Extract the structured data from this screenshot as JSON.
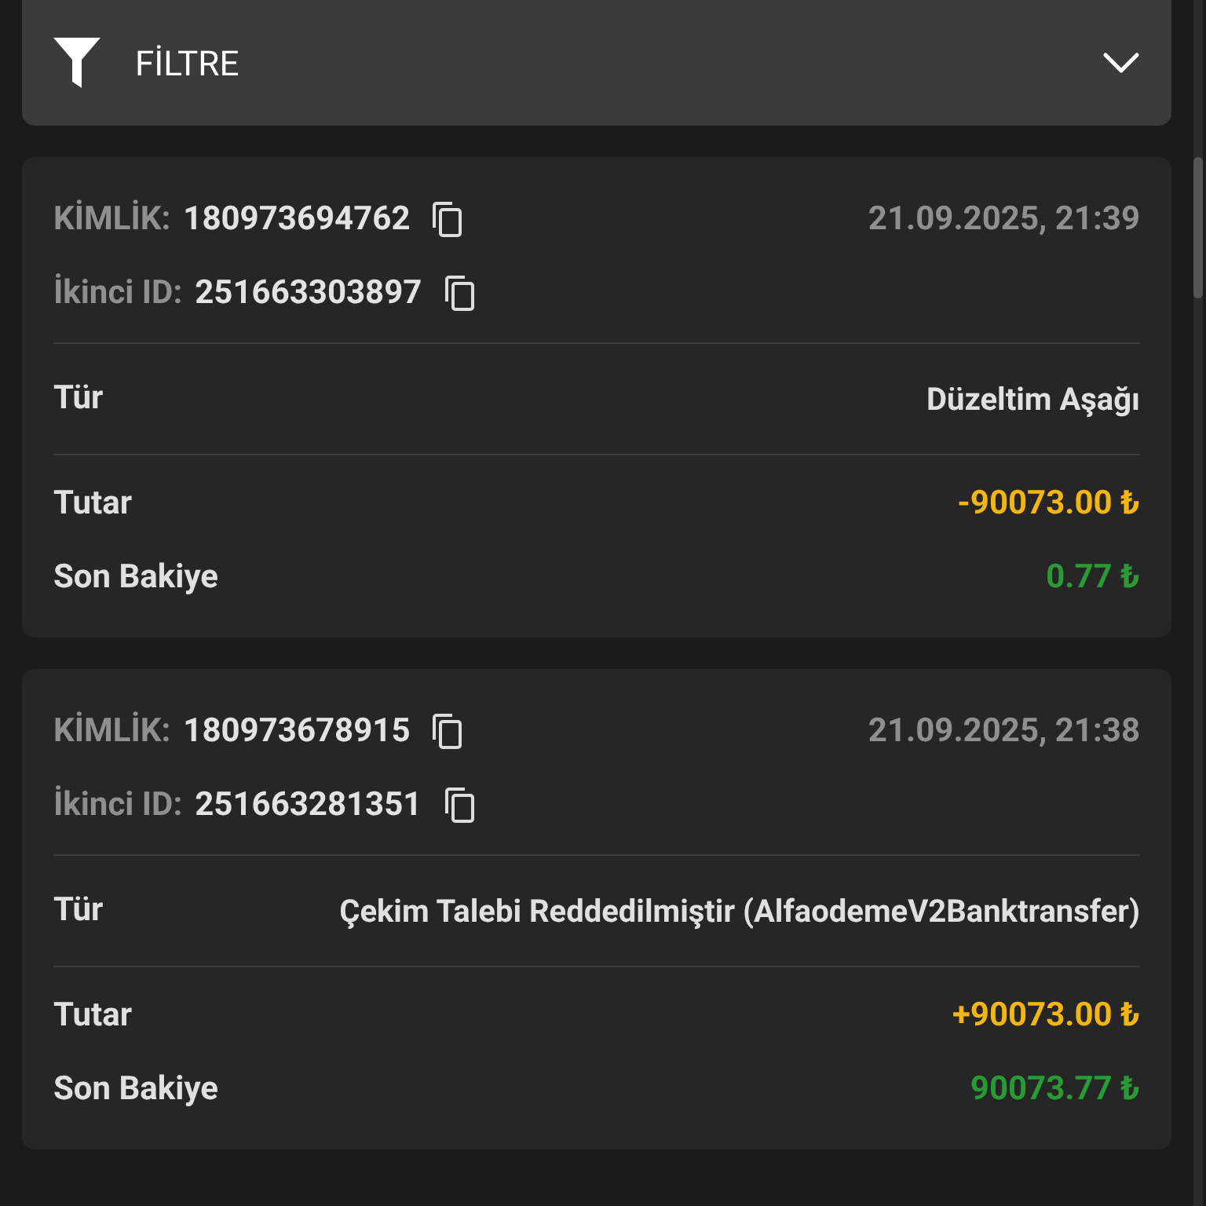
{
  "filter": {
    "label": "FİLTRE",
    "expanded": false
  },
  "transactions": [
    {
      "id_label": "KİMLİK:",
      "id": "180973694762",
      "secondary_label": "İkinci ID:",
      "secondary_id": "251663303897",
      "date": "21.09.2025, 21:39",
      "type_label": "Tür",
      "type": "Düzeltim Aşağı",
      "amount_label": "Tutar",
      "amount": "-90073.00 ₺",
      "balance_label": "Son Bakiye",
      "balance": "0.77 ₺"
    },
    {
      "id_label": "KİMLİK:",
      "id": "180973678915",
      "secondary_label": "İkinci ID:",
      "secondary_id": "251663281351",
      "date": "21.09.2025, 21:38",
      "type_label": "Tür",
      "type": "Çekim Talebi Reddedilmiştir (AlfaodemeV2Banktransfer)",
      "amount_label": "Tutar",
      "amount": "+90073.00 ₺",
      "balance_label": "Son Bakiye",
      "balance": "90073.77 ₺"
    }
  ]
}
